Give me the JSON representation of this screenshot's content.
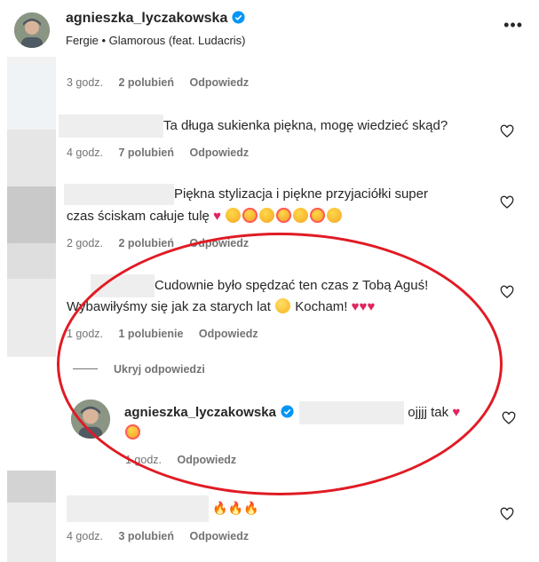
{
  "header": {
    "username": "agnieszka_lyczakowska",
    "song": "Fergie • Glamorous (feat. Ludacris)",
    "more": "•••"
  },
  "comments": [
    {
      "meta": {
        "time": "3 godz.",
        "likes": "2 polubień",
        "reply": "Odpowiedz"
      }
    },
    {
      "text": "Ta długa sukienka piękna, mogę wiedzieć skąd?",
      "meta": {
        "time": "4 godz.",
        "likes": "7 polubień",
        "reply": "Odpowiedz"
      }
    },
    {
      "text_line1": "Piękna stylizacja i piękne przyjaciółki super",
      "text_line2": "czas ściskam całuje tulę",
      "meta": {
        "time": "2 godz.",
        "likes": "2 polubień",
        "reply": "Odpowiedz"
      }
    },
    {
      "text_line1": "Cudownie było spędzać ten czas z Tobą Aguś!",
      "text_line2": "Wybawiłyśmy się jak za starych lat",
      "text_line2b": "Kocham!",
      "meta": {
        "time": "1 godz.",
        "likes": "1 polubienie",
        "reply": "Odpowiedz"
      }
    }
  ],
  "hide_replies": "Ukryj odpowiedzi",
  "reply": {
    "username": "agnieszka_lyczakowska",
    "text": "ojjjj tak",
    "meta": {
      "time": "1 godz.",
      "reply": "Odpowiedz"
    }
  },
  "last_comment": {
    "meta": {
      "time": "4 godz.",
      "likes": "3 polubień",
      "reply": "Odpowiedz"
    }
  },
  "colors": {
    "highlight_circle": "#e01b24",
    "heart_emoji": "#e0245e",
    "meta_text": "#737373"
  }
}
